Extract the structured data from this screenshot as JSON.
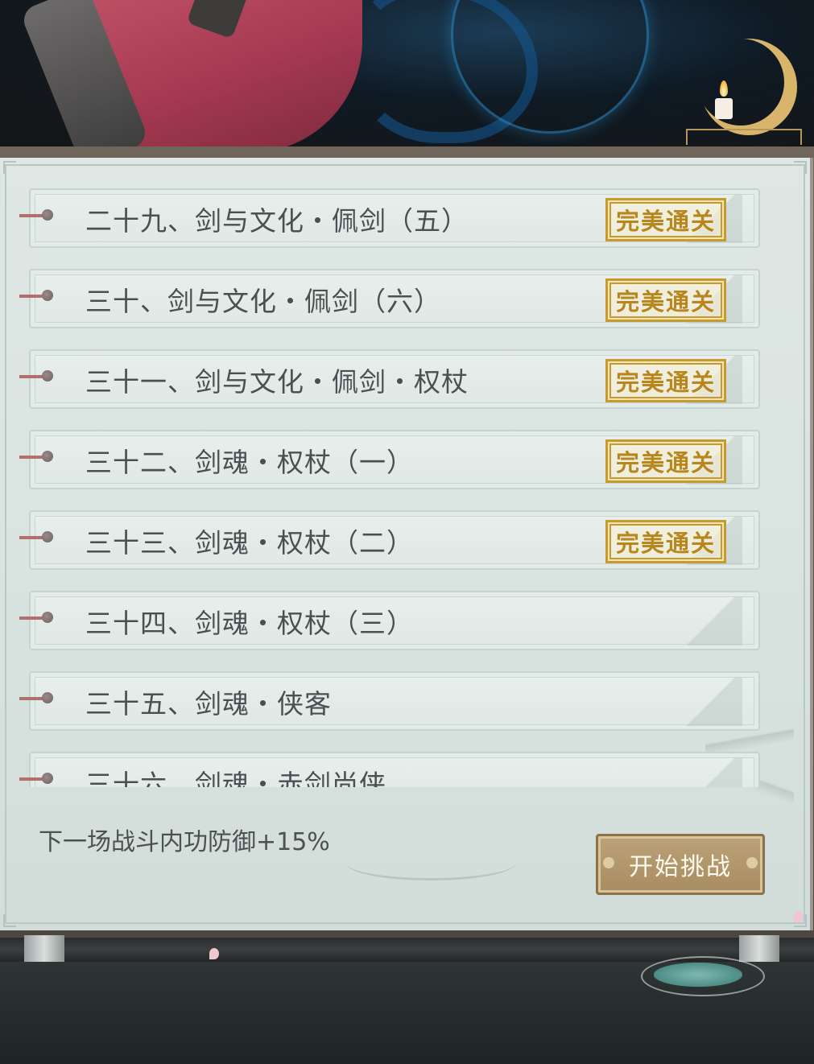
{
  "levels": [
    {
      "title": "二十九、剑与文化・佩剑（五）",
      "badge": "完美通关"
    },
    {
      "title": "三十、剑与文化・佩剑（六）",
      "badge": "完美通关"
    },
    {
      "title": "三十一、剑与文化・佩剑・权杖",
      "badge": "完美通关"
    },
    {
      "title": "三十二、剑魂・权杖（一）",
      "badge": "完美通关"
    },
    {
      "title": "三十三、剑魂・权杖（二）",
      "badge": "完美通关"
    },
    {
      "title": "三十四、剑魂・权杖（三）",
      "badge": ""
    },
    {
      "title": "三十五、剑魂・侠客",
      "badge": ""
    },
    {
      "title": "三十六、剑魂・赤剑尚侠",
      "badge": ""
    }
  ],
  "footer": {
    "buff_text": "下一场战斗内功防御+15%",
    "start_button": "开始挑战"
  },
  "colors": {
    "badge_gold": "#c79a2c",
    "button_tan": "#a88c62",
    "panel_bg": "#dfe7e4"
  },
  "icons": {
    "badge": "perfect-clear-stamp",
    "bullet": "list-bullet-pin",
    "candle": "candle-icon",
    "moon": "crescent-moon-icon"
  }
}
